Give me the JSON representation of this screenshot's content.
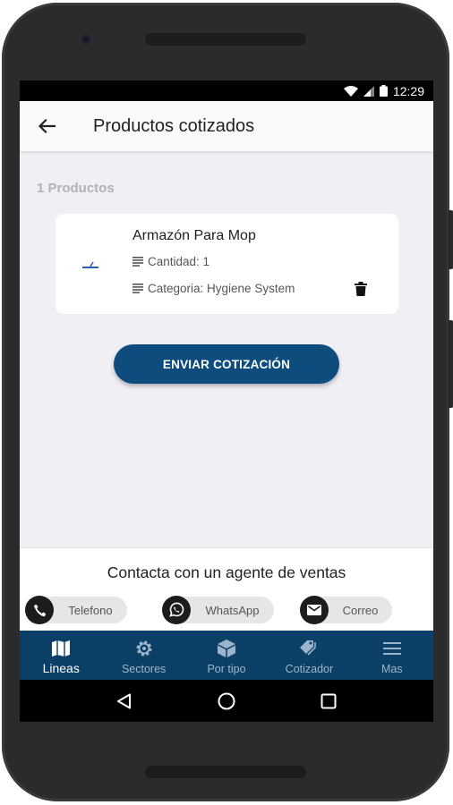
{
  "status_bar": {
    "time": "12:29"
  },
  "app_bar": {
    "title": "Productos cotizados"
  },
  "product_count": "1 Productos",
  "products": [
    {
      "name": "Armazón Para Mop",
      "quantity": "Cantidad: 1",
      "category": "Categoria: Hygiene System"
    }
  ],
  "send_button": "ENVIAR COTIZACIÓN",
  "contact": {
    "title": "Contacta con un agente de ventas",
    "phone": "Telefono",
    "whatsapp": "WhatsApp",
    "email": "Correo"
  },
  "bottom_nav": [
    {
      "label": "Lineas",
      "icon": "map-icon",
      "active": true
    },
    {
      "label": "Sectores",
      "icon": "gear-icon",
      "active": false
    },
    {
      "label": "Por tipo",
      "icon": "box-icon",
      "active": false
    },
    {
      "label": "Cotizador",
      "icon": "tag-icon",
      "active": false
    },
    {
      "label": "Mas",
      "icon": "menu-icon",
      "active": false
    }
  ],
  "colors": {
    "primary": "#0e4c7d",
    "nav_background": "#0c3f66",
    "screen_background": "#f0eff4"
  }
}
